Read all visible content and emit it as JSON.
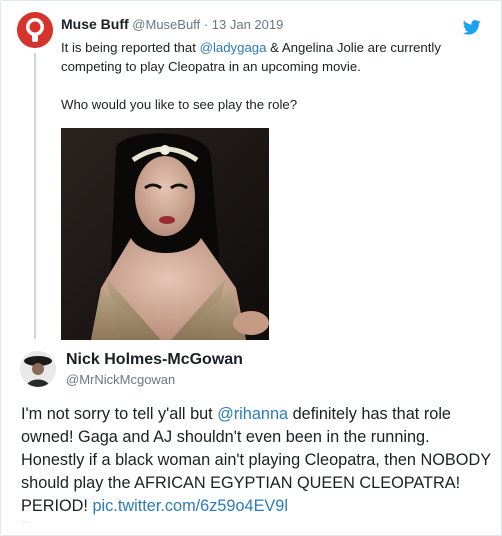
{
  "quoted_tweet": {
    "name": "Muse Buff",
    "handle": "@MuseBuff",
    "separator": "·",
    "date": "13 Jan 2019",
    "text_before_mention": "It is being reported that ",
    "mention": "@ladygaga",
    "text_after_mention": " & Angelina Jolie are currently competing to play Cleopatra in an upcoming movie.",
    "second_paragraph": "Who would you like to see play the role?",
    "avatar_icon": "muse-buff-avatar-icon",
    "media": "photo"
  },
  "main_tweet": {
    "name": "Nick Holmes-McGowan",
    "handle": "@MrNickMcgowan",
    "text_before_mention": "I'm not sorry to tell y'all but ",
    "mention": "@rihanna",
    "text_after_mention": " definitely has that role owned! Gaga and AJ shouldn't even been in the running. Honestly if a black woman ain't playing Cleopatra, then NOBODY should play the AFRICAN EGYPTIAN QUEEN CLEOPATRA! PERIOD! ",
    "link": "pic.twitter.com/6z59o4EV9l"
  },
  "icons": {
    "brand": "twitter-bird-icon"
  },
  "colors": {
    "link": "#2b7bb9",
    "twitter_blue": "#1da1f2",
    "muted": "#697882",
    "text": "#1c2022",
    "border": "#e1e8ed"
  }
}
